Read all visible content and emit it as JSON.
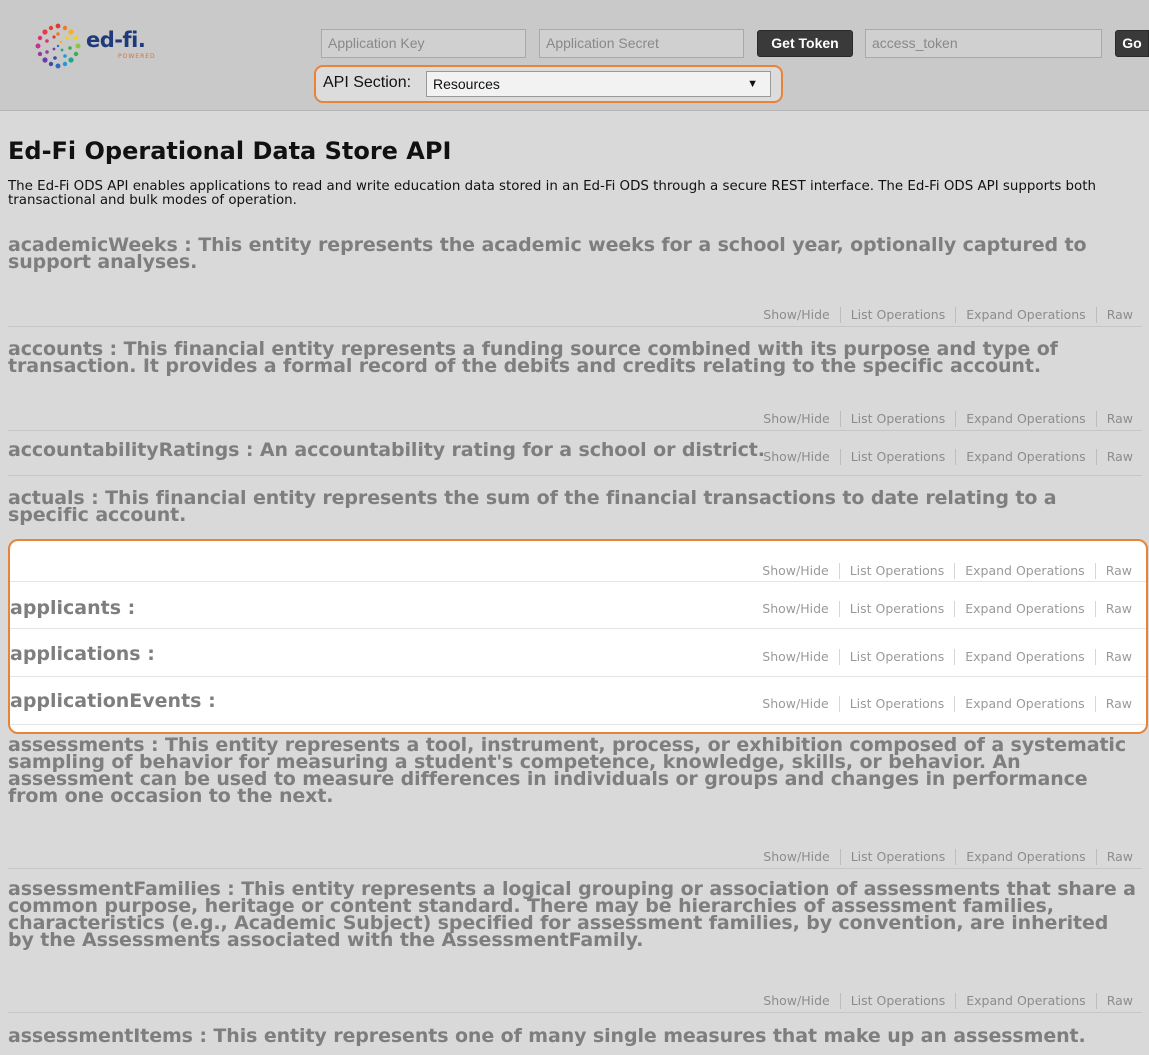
{
  "header": {
    "logo": {
      "word": "ed-fi.",
      "sub": "POWERED"
    },
    "app_key_placeholder": "Application Key",
    "app_secret_placeholder": "Application Secret",
    "get_token_label": "Get Token",
    "access_token_placeholder": "access_token",
    "go_label": "Go",
    "api_section_label": "API Section:",
    "api_section_value": "Resources"
  },
  "page": {
    "title": "Ed-Fi Operational Data Store API",
    "description": "The Ed-Fi ODS API enables applications to read and write education data stored in an Ed-Fi ODS through a secure REST interface. The Ed-Fi ODS API supports both transactional and bulk modes of operation."
  },
  "ops_labels": {
    "show_hide": "Show/Hide",
    "list_operations": "List Operations",
    "expand_operations": "Expand Operations",
    "raw": "Raw"
  },
  "resources": [
    {
      "name": "academicWeeks",
      "description": "This entity represents the academic weeks for a school year, optionally captured to support analyses."
    },
    {
      "name": "accounts",
      "description": "This financial entity represents a funding source combined with its purpose and type of transaction. It provides a formal record of the debits and credits relating to the specific account."
    },
    {
      "name": "accountabilityRatings",
      "description": "An accountability rating for a school or district."
    },
    {
      "name": "actuals",
      "description": "This financial entity represents the sum of the financial transactions to date relating to a specific account."
    },
    {
      "name": "applicants",
      "description": ""
    },
    {
      "name": "applications",
      "description": ""
    },
    {
      "name": "applicationEvents",
      "description": ""
    },
    {
      "name": "assessments",
      "description": "This entity represents a tool, instrument, process, or exhibition composed of a systematic sampling of behavior for measuring a student's competence, knowledge, skills, or behavior. An assessment can be used to measure differences in individuals or groups and changes in performance from one occasion to the next."
    },
    {
      "name": "assessmentFamilies",
      "description": "This entity represents a logical grouping or association of assessments that share a common purpose, heritage or content standard. There may be hierarchies of assessment families, characteristics (e.g., Academic Subject) specified for assessment families, by convention, are inherited by the Assessments associated with the AssessmentFamily."
    },
    {
      "name": "assessmentItems",
      "description": "This entity represents one of many single measures that make up an assessment."
    }
  ],
  "colors": {
    "accent_orange": "#e8833a",
    "topbar_bg": "#c9c9c9",
    "page_bg": "#d9d9d9",
    "resource_heading": "#7e7e7e",
    "button_dark": "#3a3a3a"
  }
}
